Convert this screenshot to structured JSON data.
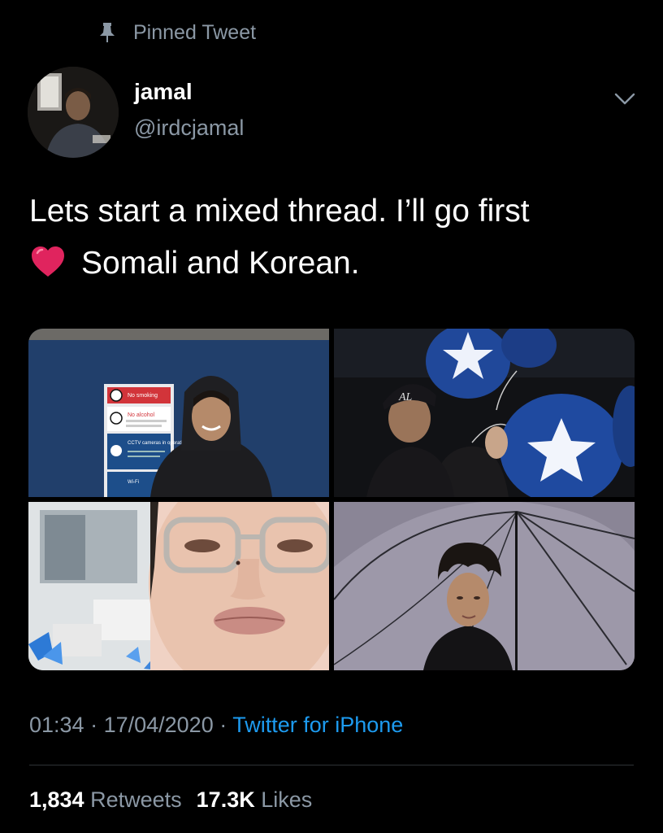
{
  "pinned_label": "Pinned Tweet",
  "author": {
    "name": "jamal",
    "handle": "@irdcjamal"
  },
  "tweet": {
    "line1": "Lets start a mixed thread. I’ll go first",
    "line2": "Somali and Korean.",
    "emoji": "red-heart-icon"
  },
  "media": {
    "sign_lines": [
      "No smoking",
      "No alcohol",
      "CCTV cameras in operation",
      "Wi-Fi"
    ],
    "cap_text": "AL"
  },
  "meta": {
    "time": "01:34",
    "separator": " · ",
    "date": "17/04/2020",
    "source": "Twitter for iPhone"
  },
  "stats": {
    "retweets_count": "1,834",
    "retweets_label": "Retweets",
    "likes_count": "17.3K",
    "likes_label": "Likes"
  },
  "colors": {
    "background": "#000000",
    "secondary_text": "#8b98a5",
    "link": "#1d9bf0",
    "heart": "#e0245e"
  }
}
